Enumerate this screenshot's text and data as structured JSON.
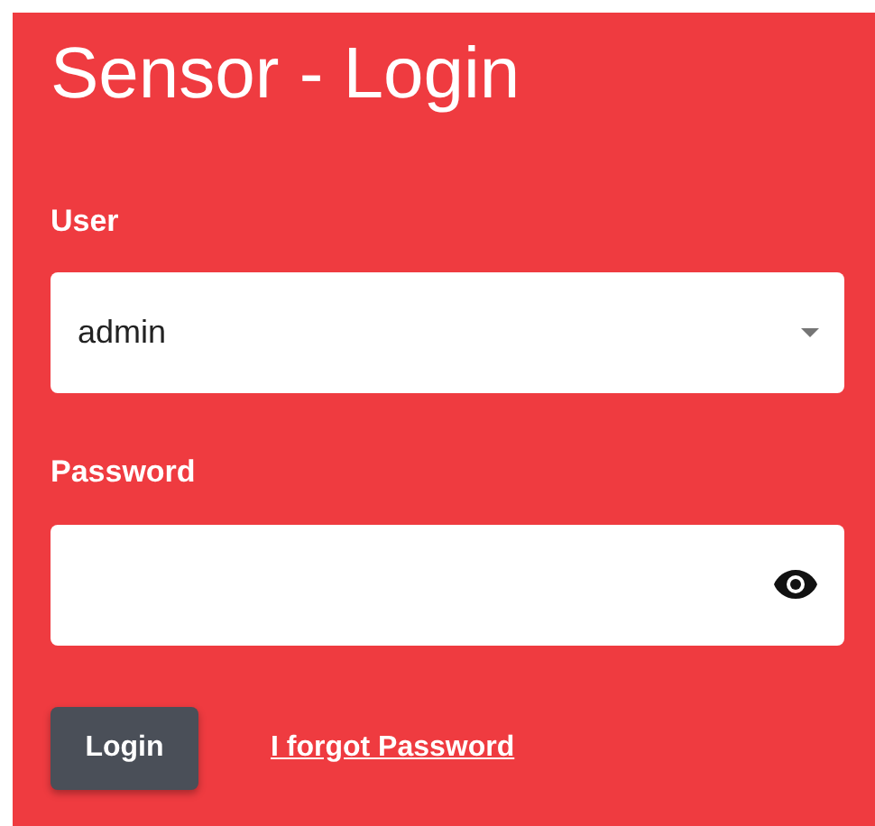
{
  "title": "Sensor - Login",
  "fields": [
    {
      "kind": "select",
      "label": "User",
      "value": "admin"
    },
    {
      "kind": "password",
      "label": "Password"
    }
  ],
  "buttons": [
    {
      "label": "Login"
    }
  ],
  "links": [
    {
      "label": "I forgot Password"
    }
  ]
}
